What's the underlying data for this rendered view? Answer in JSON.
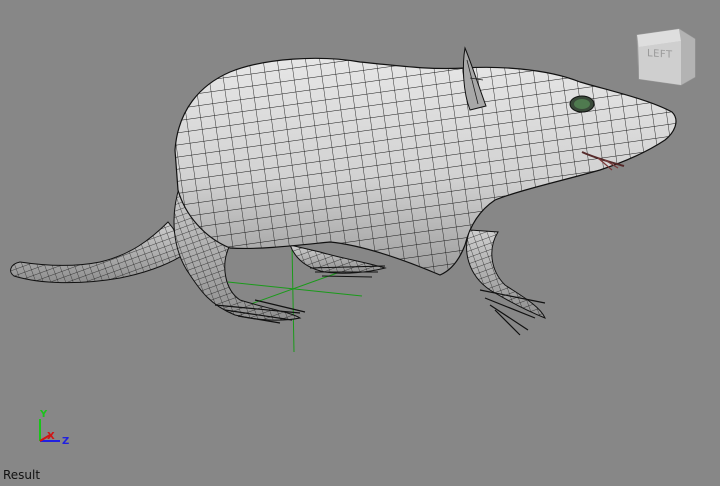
{
  "viewport": {
    "view_name": "Result",
    "background_color": "#878787"
  },
  "viewcube": {
    "face_label": "LEFT",
    "icon": "view-cube-icon"
  },
  "axis_triad": {
    "icon": "axis-triad-icon",
    "x_label": "X",
    "y_label": "Y",
    "z_label": "Z",
    "x_color": "#d21414",
    "y_color": "#19c419",
    "z_color": "#2020e0"
  },
  "scene": {
    "model": "rat-wireframe-mesh",
    "mesh_color": "#d4d4d4",
    "wire_color": "#1a1a1a",
    "pivot_gizmo_color": "#1a9a1a"
  }
}
